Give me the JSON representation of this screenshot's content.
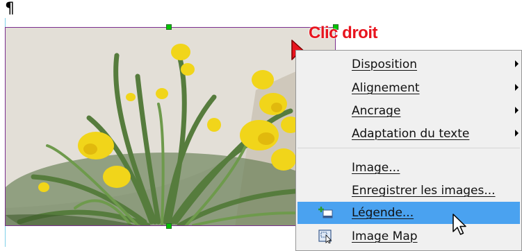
{
  "document": {
    "paragraph_mark": "¶"
  },
  "annotation": {
    "text": "Clic droit",
    "color": "#e8141e"
  },
  "context_menu": {
    "items": [
      {
        "label": "Disposition",
        "submenu": true
      },
      {
        "label": "Alignement",
        "submenu": true
      },
      {
        "label": "Ancrage",
        "submenu": true
      },
      {
        "label": "Adaptation du texte",
        "submenu": true
      },
      {
        "label": "Image...",
        "submenu": false
      },
      {
        "label": "Enregistrer les images...",
        "submenu": false
      },
      {
        "label": "Légende...",
        "submenu": false,
        "highlighted": true,
        "icon": "caption-icon"
      },
      {
        "label": "Image Map",
        "submenu": false,
        "icon": "image-map-icon"
      }
    ]
  },
  "colors": {
    "selection_border": "#7b2e8e",
    "handle": "#00c400",
    "menu_highlight": "#4aa2f0"
  }
}
